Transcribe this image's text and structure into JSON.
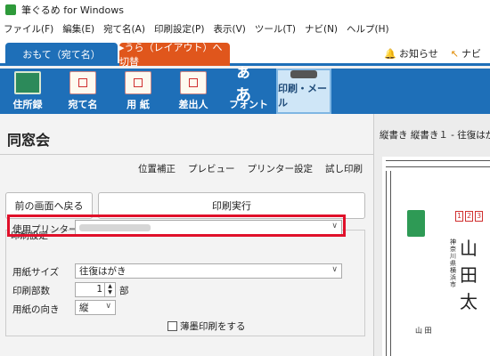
{
  "window": {
    "title": "筆ぐるめ for Windows"
  },
  "menu": [
    "ファイル(F)",
    "編集(E)",
    "宛て名(A)",
    "印刷設定(P)",
    "表示(V)",
    "ツール(T)",
    "ナビ(N)",
    "ヘルプ(H)"
  ],
  "mode_tabs": {
    "omote": "おもて（宛て名）",
    "ura": "▸うら（レイアウト）へ切替"
  },
  "top_links": {
    "news": "お知らせ",
    "navi": "ナビ"
  },
  "toolbar": [
    {
      "label": "住所録"
    },
    {
      "label": "宛て名"
    },
    {
      "label": "用 紙"
    },
    {
      "label": "差出人"
    },
    {
      "label": "フォント",
      "glyph": "ぁあ"
    },
    {
      "label": "印刷・メール"
    }
  ],
  "panel": {
    "title": "同窓会",
    "links": [
      "位置補正",
      "プレビュー",
      "プリンター設定",
      "試し印刷"
    ],
    "back_button": "前の画面へ戻る",
    "exec_button": "印刷実行",
    "group_label": "印刷設定",
    "printer_label": "使用プリンター",
    "paper_size_label": "用紙サイズ",
    "paper_size_value": "往復はがき",
    "copies_label": "印刷部数",
    "copies_value": "1",
    "copies_unit": "部",
    "orientation_label": "用紙の向き",
    "orientation_value": "縦",
    "thin_print_label": "薄墨印刷をする"
  },
  "preview": {
    "title": "縦書き 縦書き１ - 往復はがき",
    "zip": [
      "1",
      "2",
      "3"
    ],
    "recipient": "山田太",
    "address_fragment": "神奈川県横浜市",
    "sender": "山 田"
  }
}
